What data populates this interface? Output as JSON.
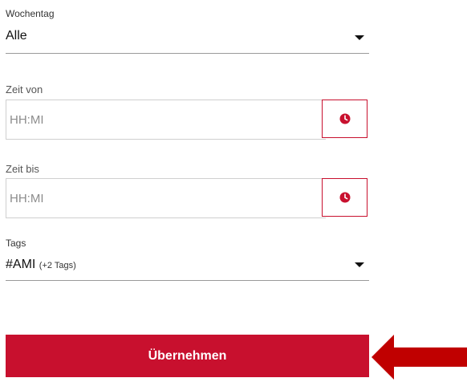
{
  "weekday": {
    "label": "Wochentag",
    "value": "Alle"
  },
  "time_from": {
    "label": "Zeit von",
    "placeholder": "HH:MI",
    "icon": "clock-icon"
  },
  "time_to": {
    "label": "Zeit bis",
    "placeholder": "HH:MI",
    "icon": "clock-icon"
  },
  "tags": {
    "label": "Tags",
    "value": "#AMI",
    "extra": "(+2 Tags)"
  },
  "submit": {
    "label": "Übernehmen"
  },
  "colors": {
    "accent": "#c8102e",
    "arrow": "#c00000"
  }
}
